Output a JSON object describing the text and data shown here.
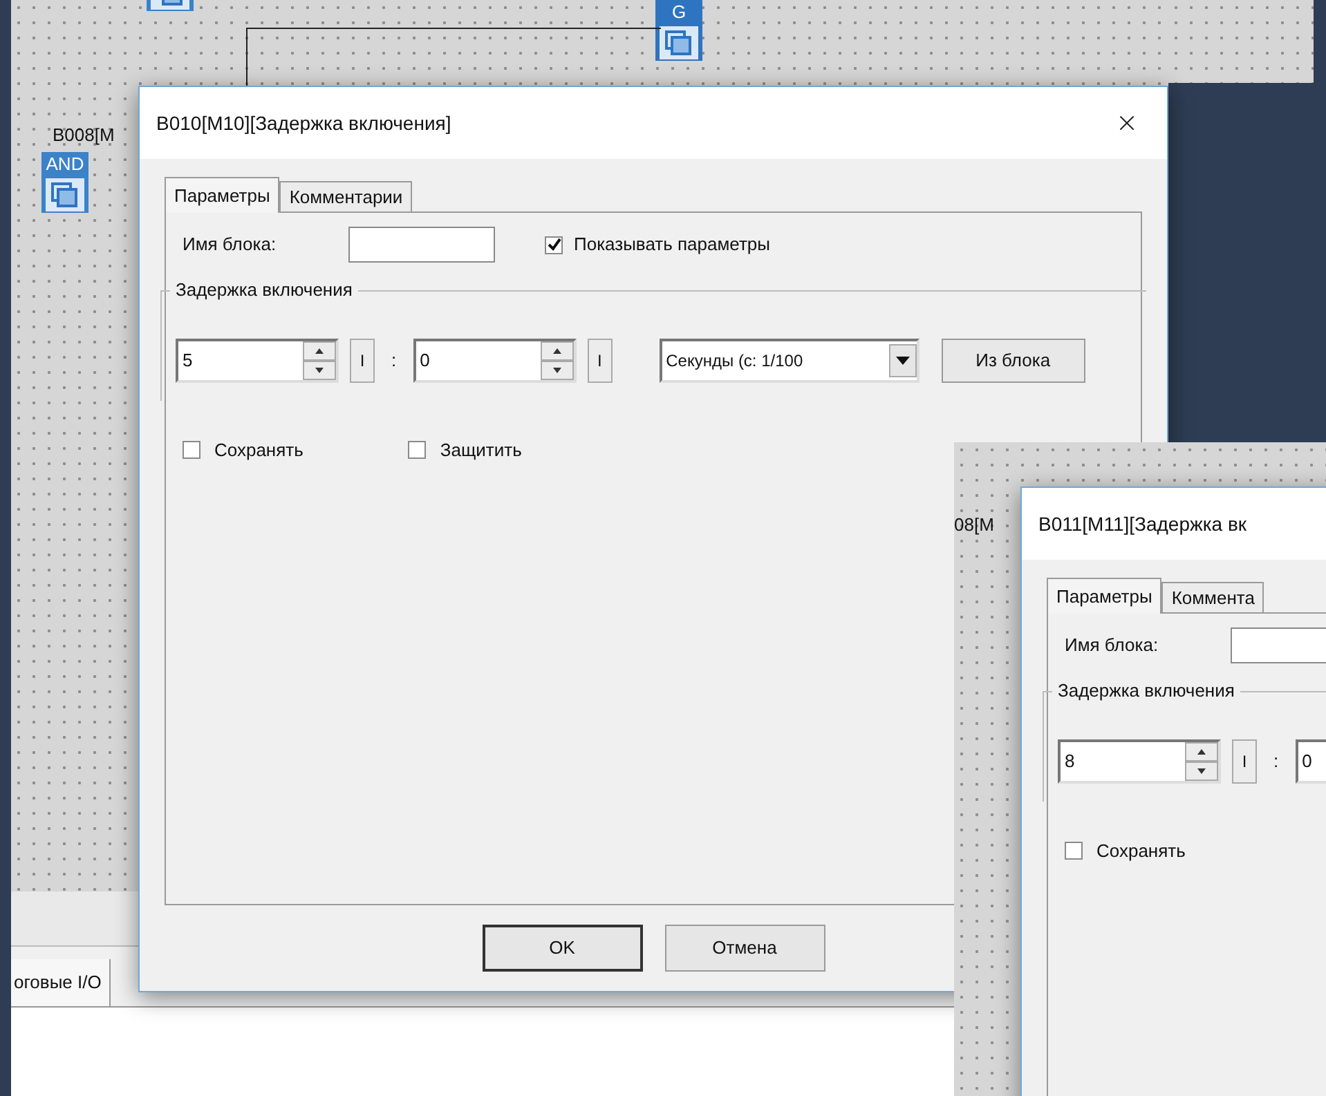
{
  "left_screen": {
    "block_labels": [
      "B008[M"
    ],
    "gates": [
      {
        "label": "AND"
      },
      {
        "label": "G"
      }
    ],
    "bottom_tab": "оговые I/O"
  },
  "dialogs": [
    {
      "title": "B010[M10][Задержка включения]",
      "tabs": [
        {
          "label": "Параметры",
          "selected": true
        },
        {
          "label": "Комментарии",
          "selected": false
        }
      ],
      "block_name_label": "Имя блока:",
      "show_params": {
        "label": "Показывать параметры",
        "checked": true
      },
      "group_title": "Задержка включения",
      "fields": [
        {
          "value": "5",
          "button": "I"
        },
        {
          "value": "0",
          "button": "I"
        }
      ],
      "separator": ":",
      "unit_select": "Секунды (с: 1/100",
      "from_block_button": "Из блока",
      "options": [
        {
          "label": "Сохранять",
          "checked": false
        },
        {
          "label": "Защитить",
          "checked": false
        }
      ],
      "buttons": [
        "OK",
        "Отмена"
      ]
    },
    {
      "title": "B011[M11][Задержка вк",
      "tabs": [
        {
          "label": "Параметры",
          "selected": true
        },
        {
          "label": "Коммента",
          "selected": false
        }
      ],
      "block_name_label": "Имя блока:",
      "group_title": "Задержка включения",
      "fields": [
        {
          "value": "8",
          "button": "I"
        },
        {
          "value": "0"
        }
      ],
      "separator": ":",
      "options": [
        {
          "label": "Сохранять",
          "checked": false
        }
      ]
    }
  ],
  "right_screen": {
    "block_labels": [
      "08[M"
    ]
  }
}
